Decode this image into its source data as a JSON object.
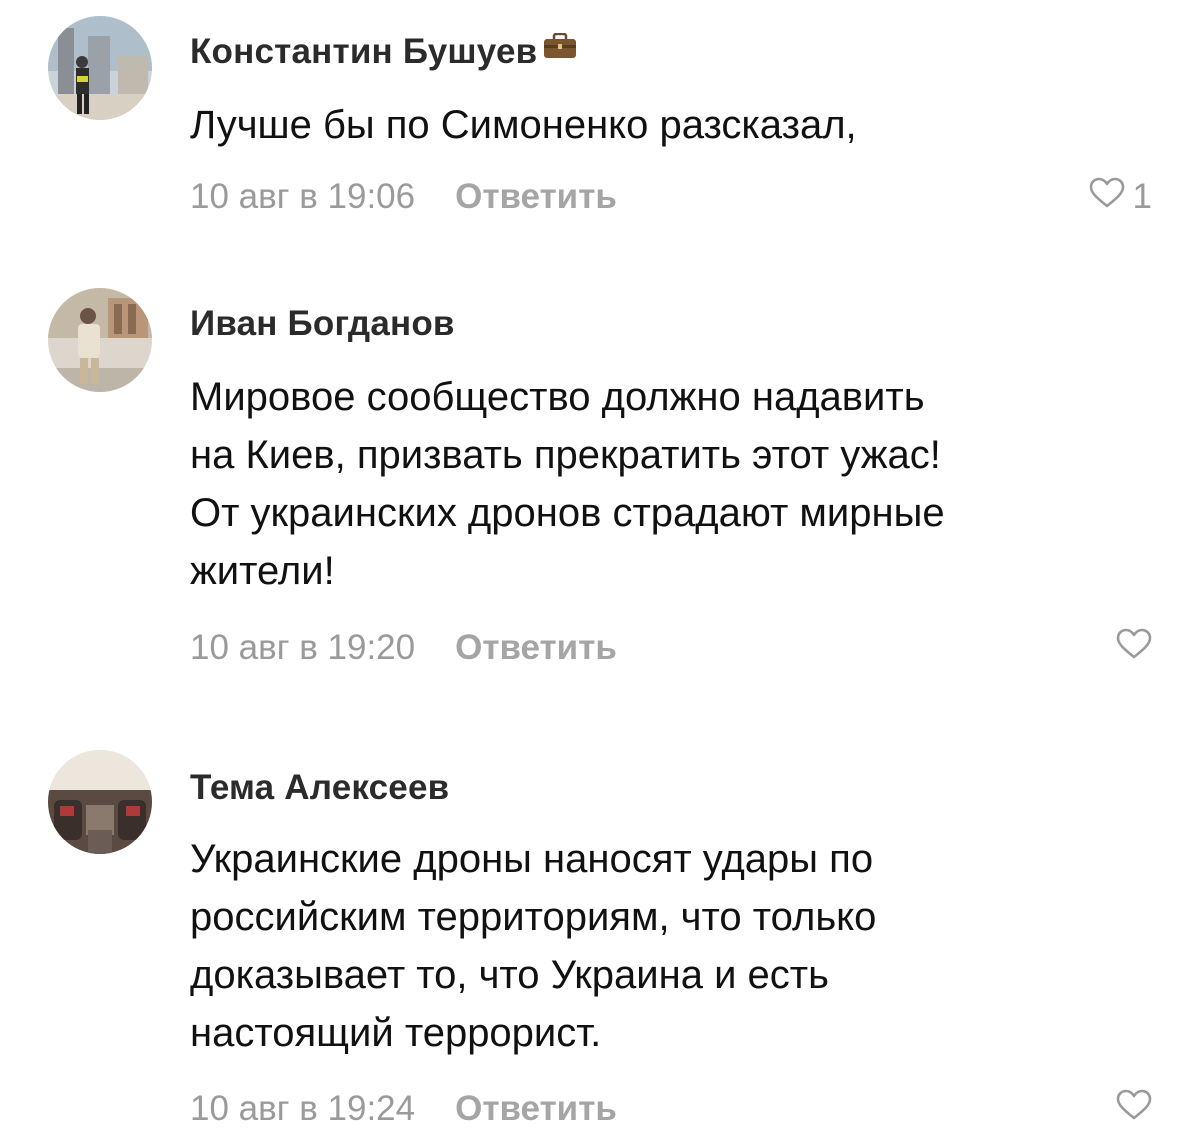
{
  "comments": [
    {
      "author": "Константин Бушуев",
      "lines": [
        "Лучше бы по Симоненко разсказал,"
      ],
      "timestamp": "10 авг в 19:06",
      "reply_label": "Ответить",
      "likes": "1"
    },
    {
      "author": "Иван Богданов",
      "lines": [
        "Мировое сообщество должно надавить",
        "на Киев, призвать прекратить этот ужас!",
        "От украинских дронов страдают мирные",
        "жители!"
      ],
      "timestamp": "10 авг в 19:20",
      "reply_label": "Ответить",
      "likes": ""
    },
    {
      "author": "Тема Алексеев",
      "lines": [
        "Украинские дроны наносят удары по",
        "российским территориям, что только",
        "доказывает то, что Украина и есть",
        "настоящий террорист."
      ],
      "timestamp": "10 авг в 19:24",
      "reply_label": "Ответить",
      "likes": ""
    }
  ],
  "icons": {
    "badge": "briefcase-icon",
    "like": "heart-outline-icon"
  },
  "colors": {
    "author": "#2b2b2b",
    "text": "#111111",
    "meta": "#9a9a9a",
    "reply": "#a5a5a5",
    "heart": "#9a9a9a"
  }
}
